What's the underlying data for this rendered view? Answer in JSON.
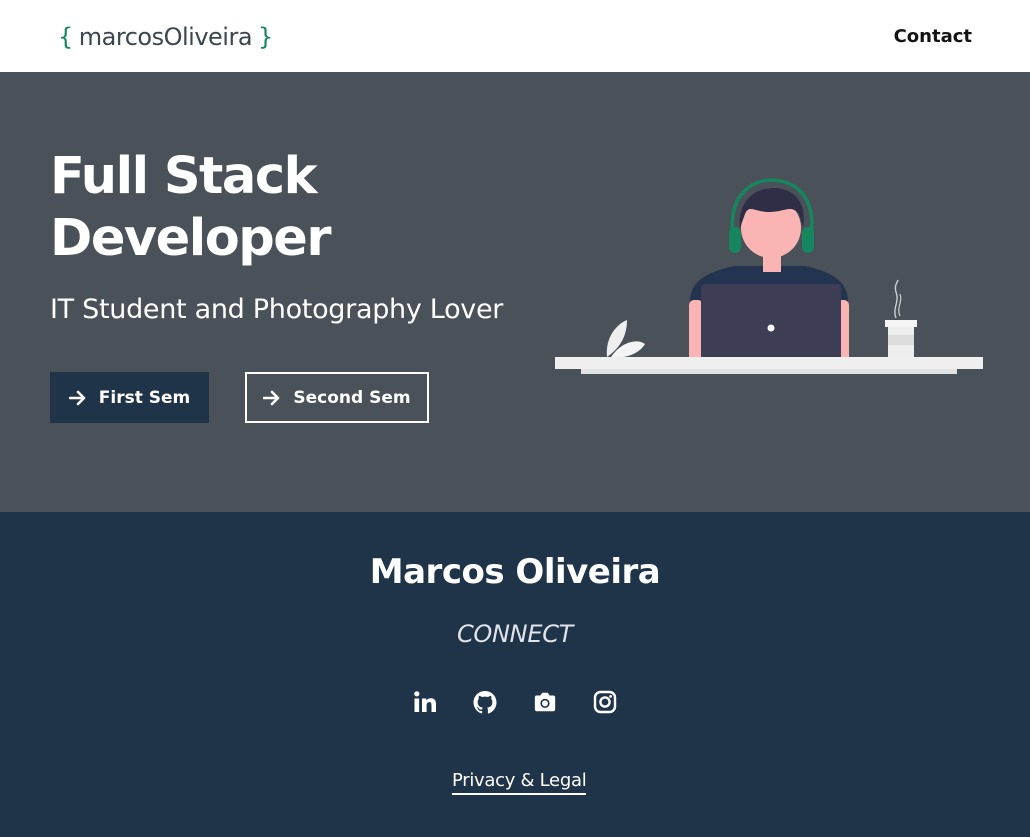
{
  "navbar": {
    "logo_brace_open": "{",
    "logo_text": "marcosOliveira",
    "logo_brace_close": "}",
    "contact_label": "Contact"
  },
  "hero": {
    "title": "Full Stack Developer",
    "subtitle": "IT Student and Photography Lover",
    "buttons": [
      {
        "label": "First Sem",
        "icon": "arrow-right-icon"
      },
      {
        "label": "Second Sem",
        "icon": "arrow-right-icon"
      }
    ],
    "illustration": "developer-at-laptop-illustration"
  },
  "footer": {
    "name": "Marcos Oliveira",
    "connect_label": "CONNECT",
    "social_icons": [
      "linkedin-icon",
      "github-icon",
      "camera-icon",
      "instagram-icon"
    ],
    "legal_label": "Privacy & Legal"
  },
  "colors": {
    "navbar_bg": "#ffffff",
    "logo_accent": "#16865f",
    "hero_bg": "#4a5159",
    "footer_bg": "#203449",
    "primary_button_bg": "#203449",
    "text_light": "#ffffff"
  }
}
